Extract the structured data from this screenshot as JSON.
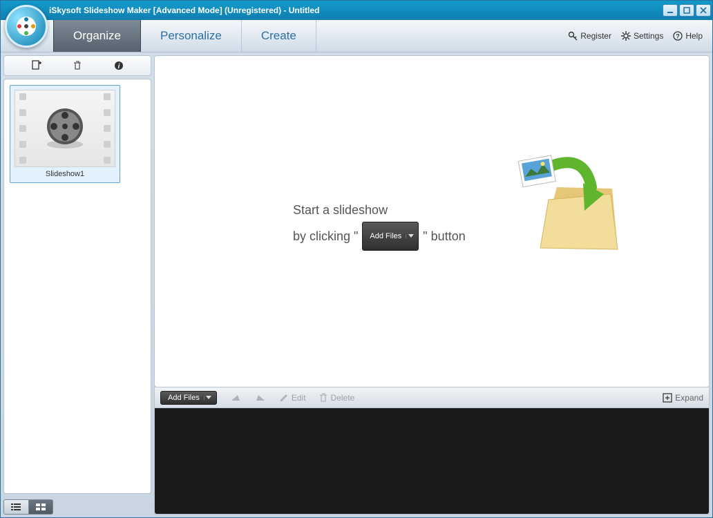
{
  "window_title": "iSkysoft Slideshow Maker [Advanced Mode] (Unregistered) - Untitled",
  "tabs": {
    "organize": "Organize",
    "personalize": "Personalize",
    "create": "Create"
  },
  "header": {
    "register": "Register",
    "settings": "Settings",
    "help": "Help"
  },
  "sidebar": {
    "slideshow1": "Slideshow1"
  },
  "hint": {
    "line1": "Start a slideshow",
    "line2_prefix": "by clicking \"",
    "line2_suffix": "\"  button",
    "addfiles_btn": "Add Files"
  },
  "toolbar": {
    "addfiles": "Add Files",
    "edit": "Edit",
    "delete": "Delete",
    "expand": "Expand"
  }
}
